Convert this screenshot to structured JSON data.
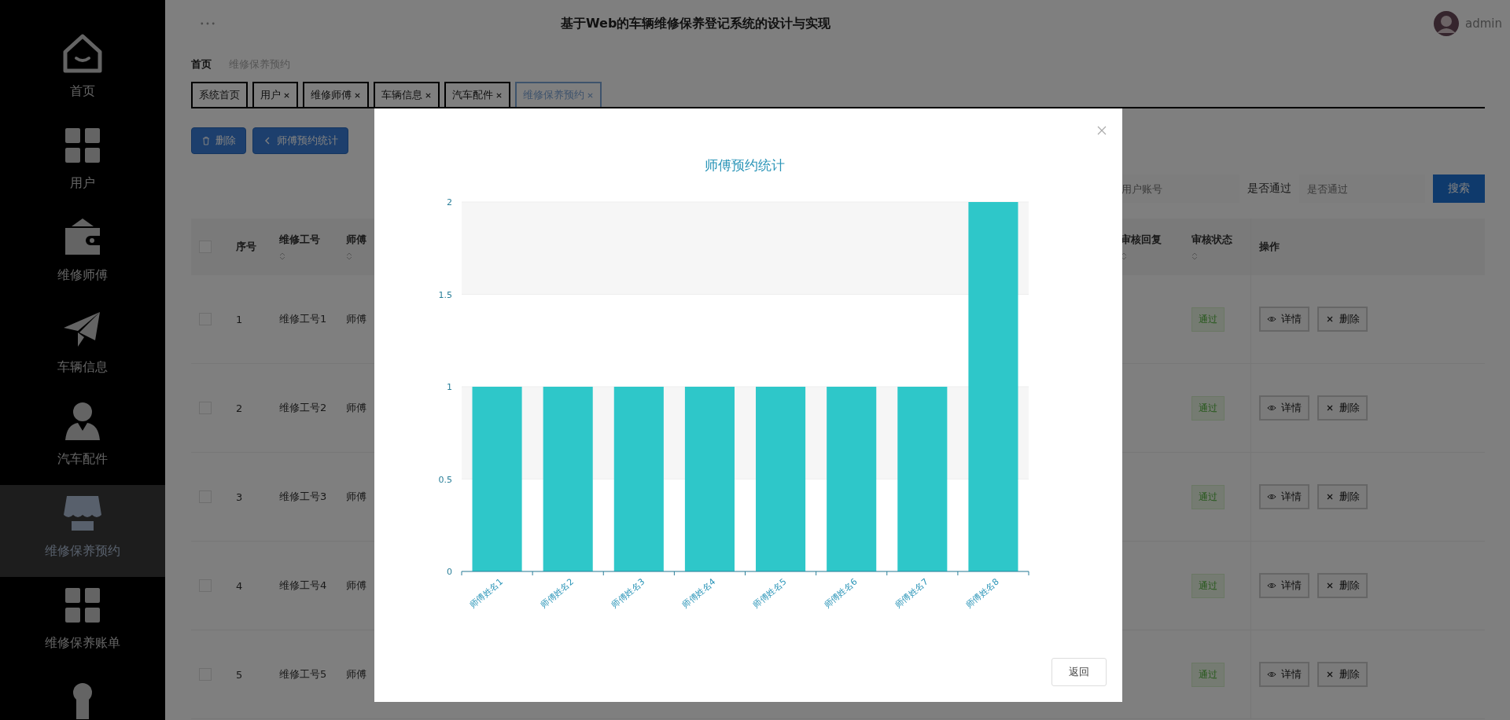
{
  "sidebar": {
    "items": [
      {
        "label": "首页",
        "selected": false
      },
      {
        "label": "用户",
        "selected": false
      },
      {
        "label": "维修师傅",
        "selected": false
      },
      {
        "label": "车辆信息",
        "selected": false
      },
      {
        "label": "汽车配件",
        "selected": false
      },
      {
        "label": "维修保养预约",
        "selected": true
      },
      {
        "label": "维修保养账单",
        "selected": false
      },
      {
        "selected": false
      }
    ]
  },
  "header": {
    "title": "基于Web的车辆维修保养登记系统的设计与实现",
    "user": "admin"
  },
  "breadcrumb": [
    "首页",
    "维修保养预约"
  ],
  "tabs": [
    {
      "label": "系统首页",
      "closable": false,
      "selected": false
    },
    {
      "label": "用户",
      "closable": true,
      "selected": false
    },
    {
      "label": "维修师傅",
      "closable": true,
      "selected": false
    },
    {
      "label": "车辆信息",
      "closable": true,
      "selected": false
    },
    {
      "label": "汽车配件",
      "closable": true,
      "selected": false
    },
    {
      "label": "维修保养预约",
      "closable": true,
      "selected": true
    }
  ],
  "actions": [
    {
      "kind": "delete",
      "label": "删除"
    },
    {
      "kind": "chart",
      "label": "师傅预约统计"
    }
  ],
  "search": {
    "fields": [
      {
        "placeholder": "用户账号"
      },
      {
        "label": "是否通过",
        "placeholder": "是否通过"
      }
    ],
    "button": "搜索"
  },
  "table": {
    "all_checked": false,
    "columns": [
      {
        "label": "序号",
        "sortable": false
      },
      {
        "label": "维修工号",
        "sortable": true
      },
      {
        "label": "师傅",
        "sortable": true
      },
      {
        "label": "审核回复",
        "sortable": true
      },
      {
        "label": "审核状态",
        "sortable": true
      },
      {
        "label": "操作",
        "sortable": false
      }
    ],
    "rows": [
      {
        "checked": false,
        "index": "1",
        "id": "维修工号1",
        "name": "师傅",
        "status": "通过",
        "actions": [
          "详情",
          "删除"
        ]
      },
      {
        "checked": false,
        "index": "2",
        "id": "维修工号2",
        "name": "师傅",
        "status": "通过",
        "actions": [
          "详情",
          "删除"
        ]
      },
      {
        "checked": false,
        "index": "3",
        "id": "维修工号3",
        "name": "师傅",
        "status": "通过",
        "actions": [
          "详情",
          "删除"
        ]
      },
      {
        "checked": false,
        "index": "4",
        "id": "维修工号4",
        "name": "师傅",
        "status": "通过",
        "actions": [
          "详情",
          "删除"
        ]
      },
      {
        "checked": false,
        "index": "5",
        "id": "维修工号5",
        "name": "师傅",
        "status": "通过",
        "actions": [
          "详情",
          "删除"
        ]
      }
    ]
  },
  "dialog": {
    "button": "返回",
    "chart_data": {
      "type": "bar",
      "title": "师傅预约统计",
      "categories": [
        "师傅姓名1",
        "师傅姓名2",
        "师傅姓名3",
        "师傅姓名4",
        "师傅姓名5",
        "师傅姓名6",
        "师傅姓名7",
        "师傅姓名8"
      ],
      "grid": true,
      "series": [
        {
          "color": "#2ec7c9",
          "values": [
            1,
            1,
            1,
            1,
            1,
            1,
            1,
            2
          ]
        }
      ],
      "ylim": [
        0,
        2
      ],
      "yticks": [
        0,
        0.5,
        1,
        1.5,
        2
      ]
    }
  }
}
